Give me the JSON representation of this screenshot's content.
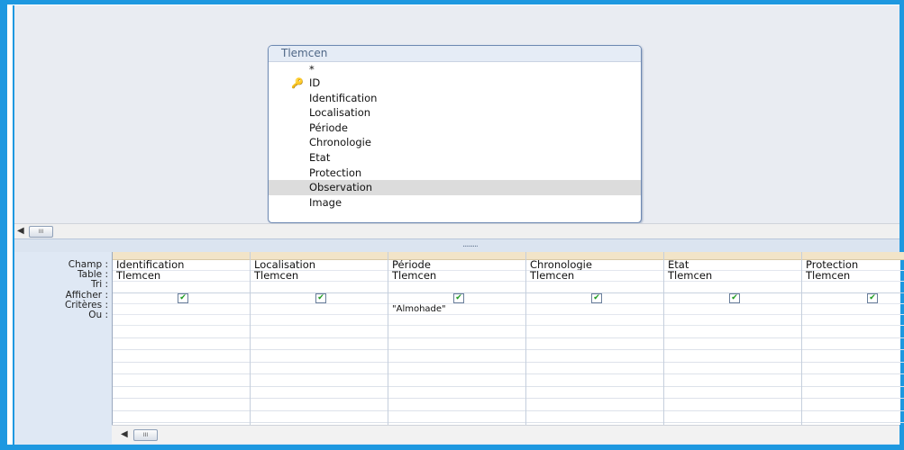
{
  "table": {
    "title": "Tlemcen",
    "fields": [
      {
        "label": "*",
        "key": false,
        "selected": false
      },
      {
        "label": "ID",
        "key": true,
        "selected": false
      },
      {
        "label": "Identification",
        "key": false,
        "selected": false
      },
      {
        "label": "Localisation",
        "key": false,
        "selected": false
      },
      {
        "label": "Période",
        "key": false,
        "selected": false
      },
      {
        "label": "Chronologie",
        "key": false,
        "selected": false
      },
      {
        "label": "Etat",
        "key": false,
        "selected": false
      },
      {
        "label": "Protection",
        "key": false,
        "selected": false
      },
      {
        "label": "Observation",
        "key": false,
        "selected": true
      },
      {
        "label": "Image",
        "key": false,
        "selected": false
      }
    ],
    "key_icon": "key-icon"
  },
  "scroll": {
    "thumb_glyph": "III",
    "arrow": "◀"
  },
  "splitter": {
    "grip": "........."
  },
  "grid": {
    "row_labels": {
      "champ": "Champ :",
      "table": "Table :",
      "tri": "Tri :",
      "afficher": "Afficher :",
      "criteres": "Critères :",
      "ou": "Ou :"
    },
    "columns": [
      {
        "champ": "Identification",
        "table": "Tlemcen",
        "tri": "",
        "afficher": true,
        "criteres": "",
        "ou": ""
      },
      {
        "champ": "Localisation",
        "table": "Tlemcen",
        "tri": "",
        "afficher": true,
        "criteres": "",
        "ou": ""
      },
      {
        "champ": "Période",
        "table": "Tlemcen",
        "tri": "",
        "afficher": true,
        "criteres": "\"Almohade\"",
        "ou": ""
      },
      {
        "champ": "Chronologie",
        "table": "Tlemcen",
        "tri": "",
        "afficher": true,
        "criteres": "",
        "ou": ""
      },
      {
        "champ": "Etat",
        "table": "Tlemcen",
        "tri": "",
        "afficher": true,
        "criteres": "",
        "ou": ""
      },
      {
        "champ": "Protection",
        "table": "Tlemcen",
        "tri": "",
        "afficher": true,
        "criteres": "",
        "ou": ""
      }
    ],
    "checkmark": "✔"
  },
  "colors": {
    "frame_blue": "#1e98e0",
    "check_green": "#1c9a1c"
  }
}
